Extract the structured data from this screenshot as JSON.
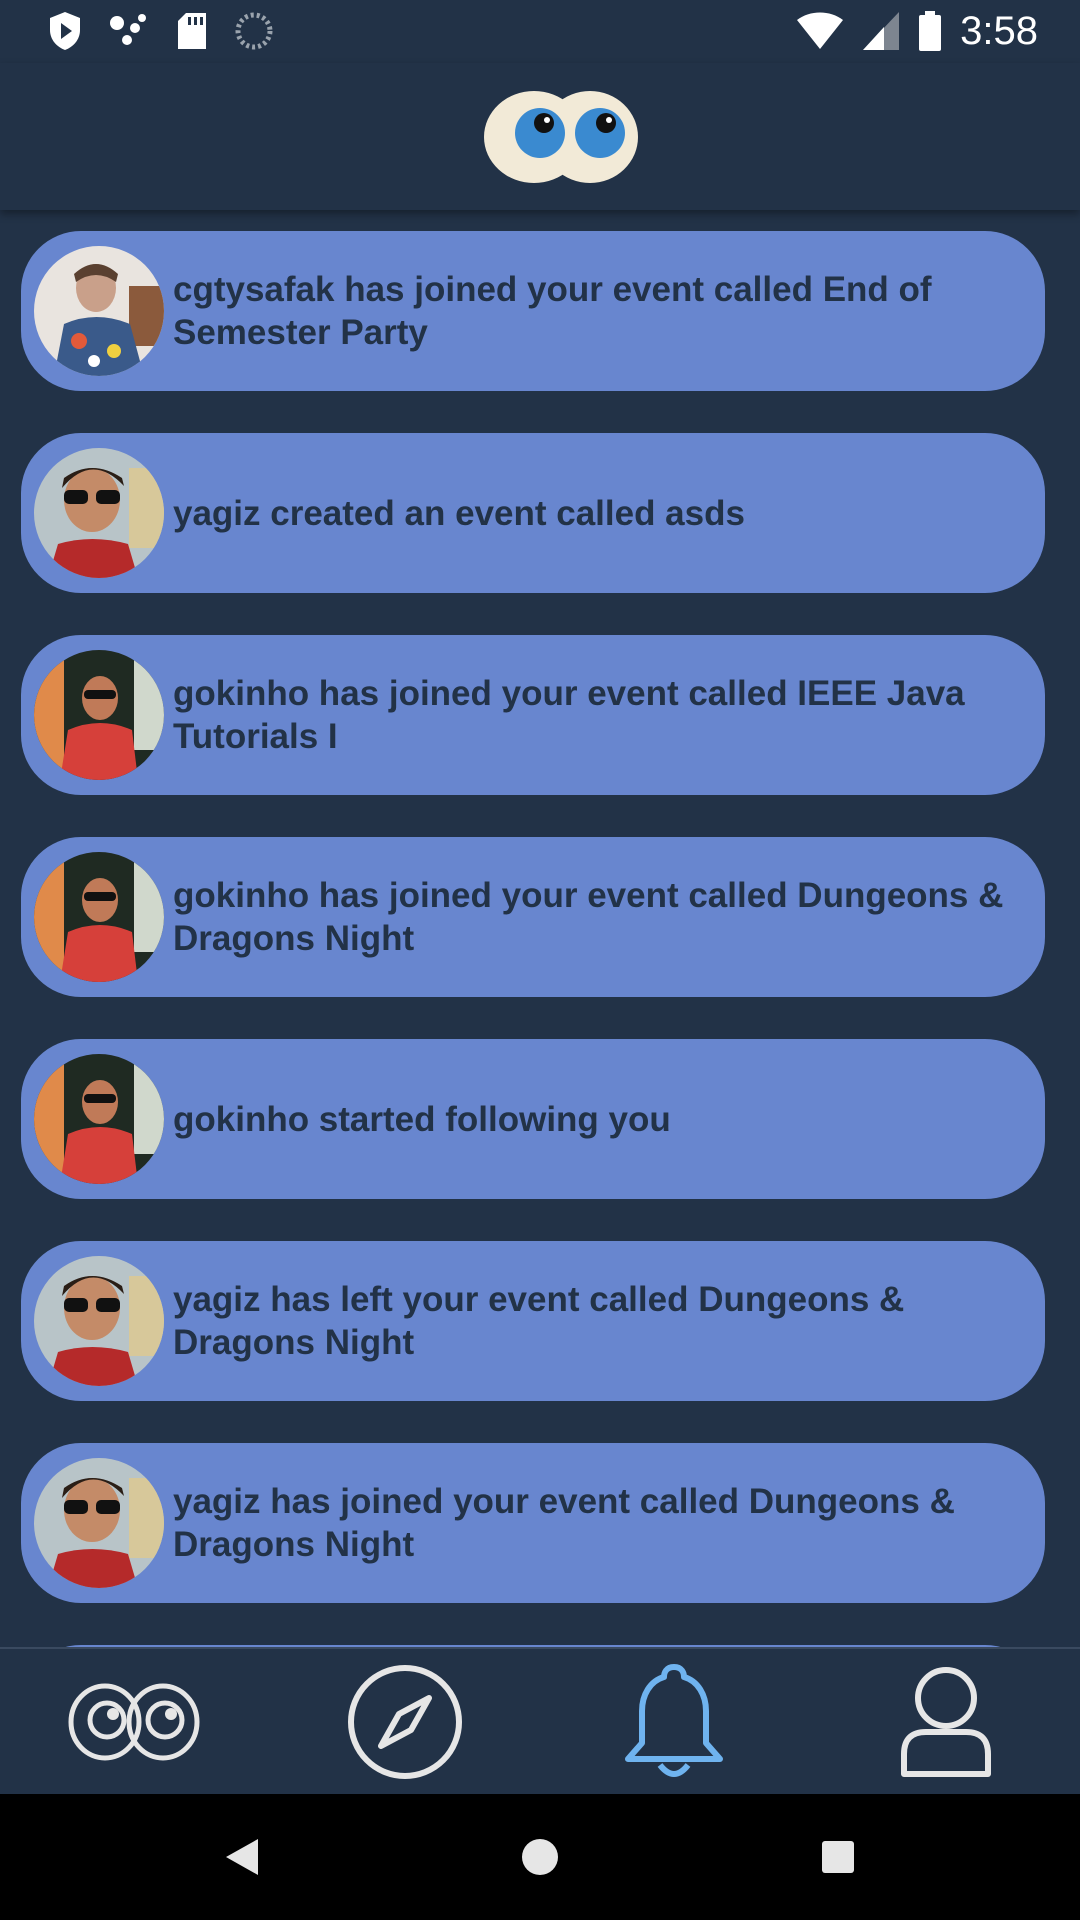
{
  "status_bar": {
    "time": "3:58",
    "icons_left": [
      "play-protect-icon",
      "assistant-dots-icon",
      "sd-card-icon",
      "sync-spinner-icon"
    ],
    "icons_right": [
      "wifi-icon",
      "cell-signal-icon",
      "battery-icon"
    ]
  },
  "header": {
    "logo": "eyes-logo-icon"
  },
  "notifications": [
    {
      "user": "cgtysafak",
      "avatar": "avatar-cgtysafak",
      "text": "cgtysafak has joined your event called End of Semester Party"
    },
    {
      "user": "yagiz",
      "avatar": "avatar-yagiz",
      "text": "yagiz created an event called asds"
    },
    {
      "user": "gokinho",
      "avatar": "avatar-gokinho",
      "text": "gokinho has joined your event called IEEE Java Tutorials I"
    },
    {
      "user": "gokinho",
      "avatar": "avatar-gokinho",
      "text": "gokinho has joined your event called Dungeons & Dragons Night"
    },
    {
      "user": "gokinho",
      "avatar": "avatar-gokinho",
      "text": "gokinho started following you"
    },
    {
      "user": "yagiz",
      "avatar": "avatar-yagiz",
      "text": "yagiz has left your event called Dungeons & Dragons Night"
    },
    {
      "user": "yagiz",
      "avatar": "avatar-yagiz",
      "text": "yagiz has joined your event called Dungeons & Dragons Night"
    }
  ],
  "bottom_nav": {
    "items": [
      {
        "name": "home",
        "icon": "eyes-icon",
        "active": false
      },
      {
        "name": "explore",
        "icon": "compass-icon",
        "active": false
      },
      {
        "name": "notifications",
        "icon": "bell-icon",
        "active": true
      },
      {
        "name": "profile",
        "icon": "user-icon",
        "active": false
      }
    ]
  },
  "colors": {
    "background": "#223247",
    "card": "#6886cf",
    "card_text": "#223247",
    "nav_inactive": "#e6e6e6",
    "nav_active": "#6fb3ef"
  }
}
